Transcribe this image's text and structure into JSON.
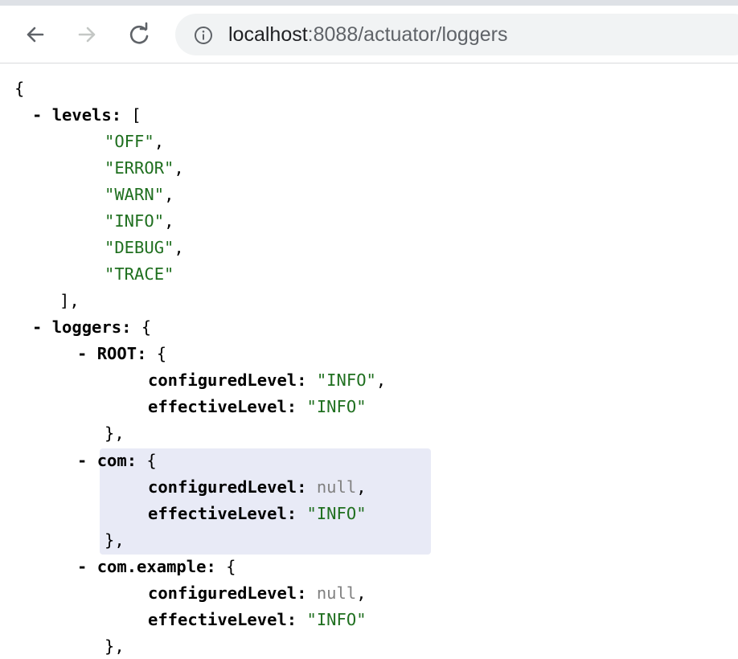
{
  "browser": {
    "url_host": "localhost",
    "url_rest": ":8088/actuator/loggers",
    "icons": [
      "back-arrow-icon",
      "forward-arrow-icon",
      "reload-icon",
      "info-icon"
    ]
  },
  "json": {
    "open_brace": "{",
    "toggle": "-",
    "levels_key": "levels",
    "levels": [
      "\"OFF\"",
      "\"ERROR\"",
      "\"WARN\"",
      "\"INFO\"",
      "\"DEBUG\"",
      "\"TRACE\""
    ],
    "loggers_key": "loggers",
    "configured_key": "configuredLevel",
    "effective_key": "effectiveLevel",
    "entries": [
      {
        "name": "ROOT",
        "configured": "\"INFO\"",
        "effective": "\"INFO\""
      },
      {
        "name": "com",
        "configured": "null",
        "effective": "\"INFO\""
      },
      {
        "name": "com.example",
        "configured": "null",
        "effective": "\"INFO\""
      }
    ]
  },
  "colors": {
    "string": "#1f6f1f",
    "null": "#808080",
    "highlight": "#e8eaf6"
  }
}
